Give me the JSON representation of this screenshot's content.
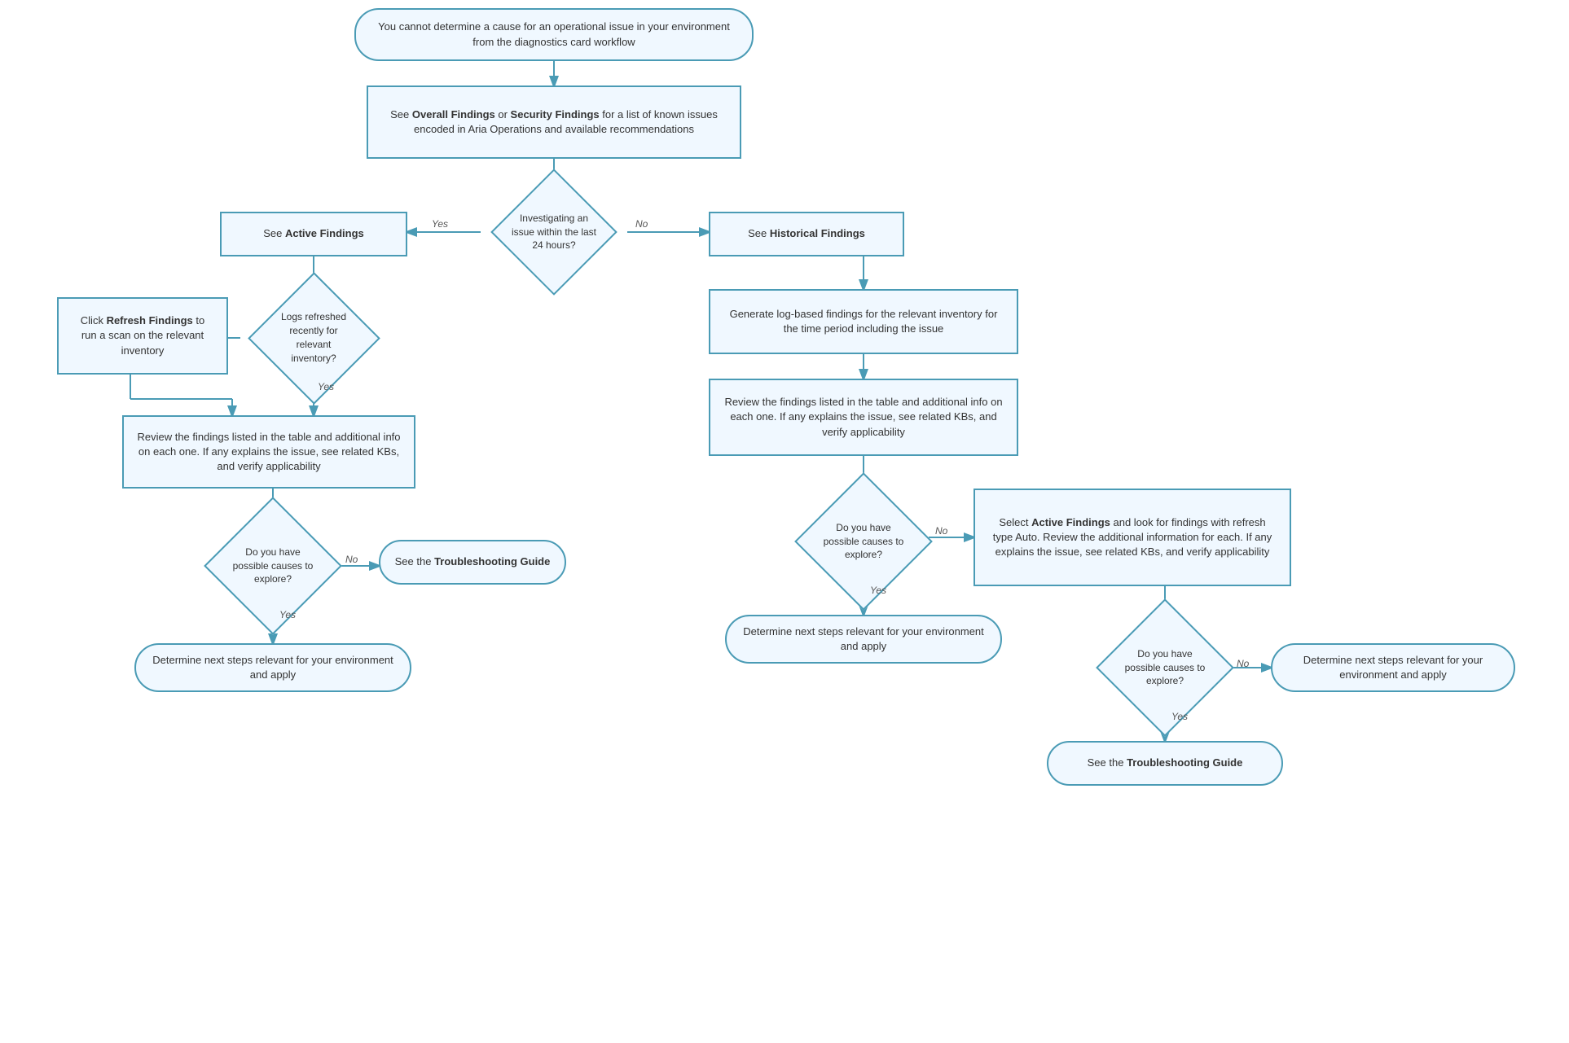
{
  "nodes": {
    "start": {
      "text": "You cannot determine a cause for an operational issue in your environment from the diagnostics card workflow"
    },
    "overall_findings": {
      "text_plain": "See ",
      "text_bold1": "Overall Findings",
      "text_mid": " or ",
      "text_bold2": "Security Findings",
      "text_end": " for a list of known issues encoded in Aria Operations and available recommendations"
    },
    "diamond_investigating": {
      "text": "Investigating an issue within the last 24 hours?"
    },
    "active_findings": {
      "text": "See Active Findings"
    },
    "historical_findings": {
      "text": "See Historical Findings"
    },
    "diamond_logs": {
      "text": "Logs refreshed recently for relevant inventory?"
    },
    "click_refresh": {
      "text_plain": "Click ",
      "text_bold": "Refresh Findings",
      "text_end": " to run a scan on the relevant inventory"
    },
    "review_active": {
      "text": "Review the findings listed in the table and additional info on each one. If any explains the issue, see related KBs, and verify applicability"
    },
    "generate_log": {
      "text": "Generate log-based findings for the relevant inventory for the time period including the issue"
    },
    "review_historical": {
      "text": "Review the findings listed in the table and additional info on each one. If any explains the issue, see related KBs, and verify applicability"
    },
    "diamond_causes_left": {
      "text": "Do you have possible causes to explore?"
    },
    "troubleshooting_left": {
      "text_plain": "See the ",
      "text_bold": "Troubleshooting Guide"
    },
    "determine_left": {
      "text": "Determine next steps relevant for your environment and apply"
    },
    "diamond_causes_mid": {
      "text": "Do you have possible causes to explore?"
    },
    "select_active": {
      "text_plain": "Select ",
      "text_bold": "Active Findings",
      "text_end": " and look for findings with refresh type Auto. Review the additional information for each. If any explains the issue, see related KBs, and verify applicability"
    },
    "determine_mid": {
      "text": "Determine next steps relevant for your environment and apply"
    },
    "diamond_causes_right": {
      "text": "Do you have possible causes to explore?"
    },
    "determine_right": {
      "text": "Determine next steps relevant for your environment and apply"
    },
    "troubleshooting_bottom": {
      "text_plain": "See the ",
      "text_bold": "Troubleshooting Guide"
    }
  },
  "labels": {
    "yes": "Yes",
    "no": "No"
  }
}
